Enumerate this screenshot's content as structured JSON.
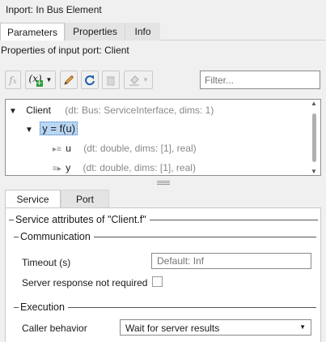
{
  "window": {
    "title": "Inport: In Bus Element"
  },
  "tabs": [
    {
      "label": "Parameters"
    },
    {
      "label": "Properties"
    },
    {
      "label": "Info"
    }
  ],
  "subtitle": "Properties of input port: Client",
  "toolbar": {
    "fx_icon": "fx-icon",
    "fx_add_label": "(x)",
    "filter_placeholder": "Filter..."
  },
  "tree": {
    "root": {
      "label": "Client",
      "meta": "(dt: Bus: ServiceInterface, dims: 1)"
    },
    "function": {
      "label": "y = f(u)"
    },
    "args": [
      {
        "label": "u",
        "meta": "(dt: double, dims: [1], real)"
      },
      {
        "label": "y",
        "meta": "(dt: double, dims: [1], real)"
      }
    ]
  },
  "panel_tabs": [
    {
      "label": "Service"
    },
    {
      "label": "Port"
    }
  ],
  "service": {
    "heading": "Service attributes of \"Client.f\"",
    "communication": {
      "heading": "Communication",
      "timeout_label": "Timeout (s)",
      "timeout_placeholder": "Default: Inf",
      "server_response_label": "Server response not required",
      "server_response_checked": false
    },
    "execution": {
      "heading": "Execution",
      "caller_behavior_label": "Caller behavior",
      "caller_behavior_value": "Wait for server results"
    }
  }
}
